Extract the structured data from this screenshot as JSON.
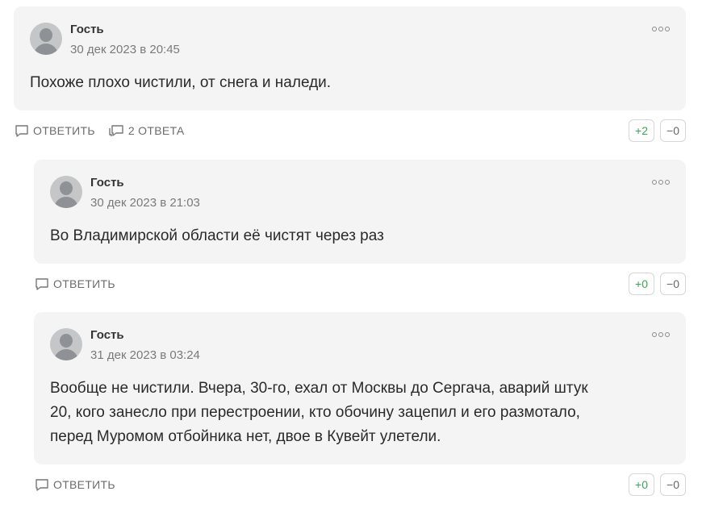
{
  "comments": [
    {
      "author": "Гость",
      "date": "30 дек 2023 в 20:45",
      "text": "Похоже плохо чистили, от снега и наледи.",
      "reply_label": "ОТВЕТИТЬ",
      "replies_label": "2 ОТВЕТА",
      "plus": "+2",
      "minus": "−0"
    },
    {
      "author": "Гость",
      "date": "30 дек 2023 в 21:03",
      "text": "Во Владимирской области её чистят через раз",
      "reply_label": "ОТВЕТИТЬ",
      "plus": "+0",
      "minus": "−0"
    },
    {
      "author": "Гость",
      "date": "31 дек 2023 в 03:24",
      "text_lines": [
        "Вообще не чистили. Вчера, 30-го, ехал от Москвы до Сергача, аварий штук",
        "20, кого занесло при перестроении, кто обочину зацепил и его размотало,",
        "перед Муромом отбойника нет, двое в Кувейт улетели."
      ],
      "reply_label": "ОТВЕТИТЬ",
      "plus": "+0",
      "minus": "−0"
    }
  ]
}
